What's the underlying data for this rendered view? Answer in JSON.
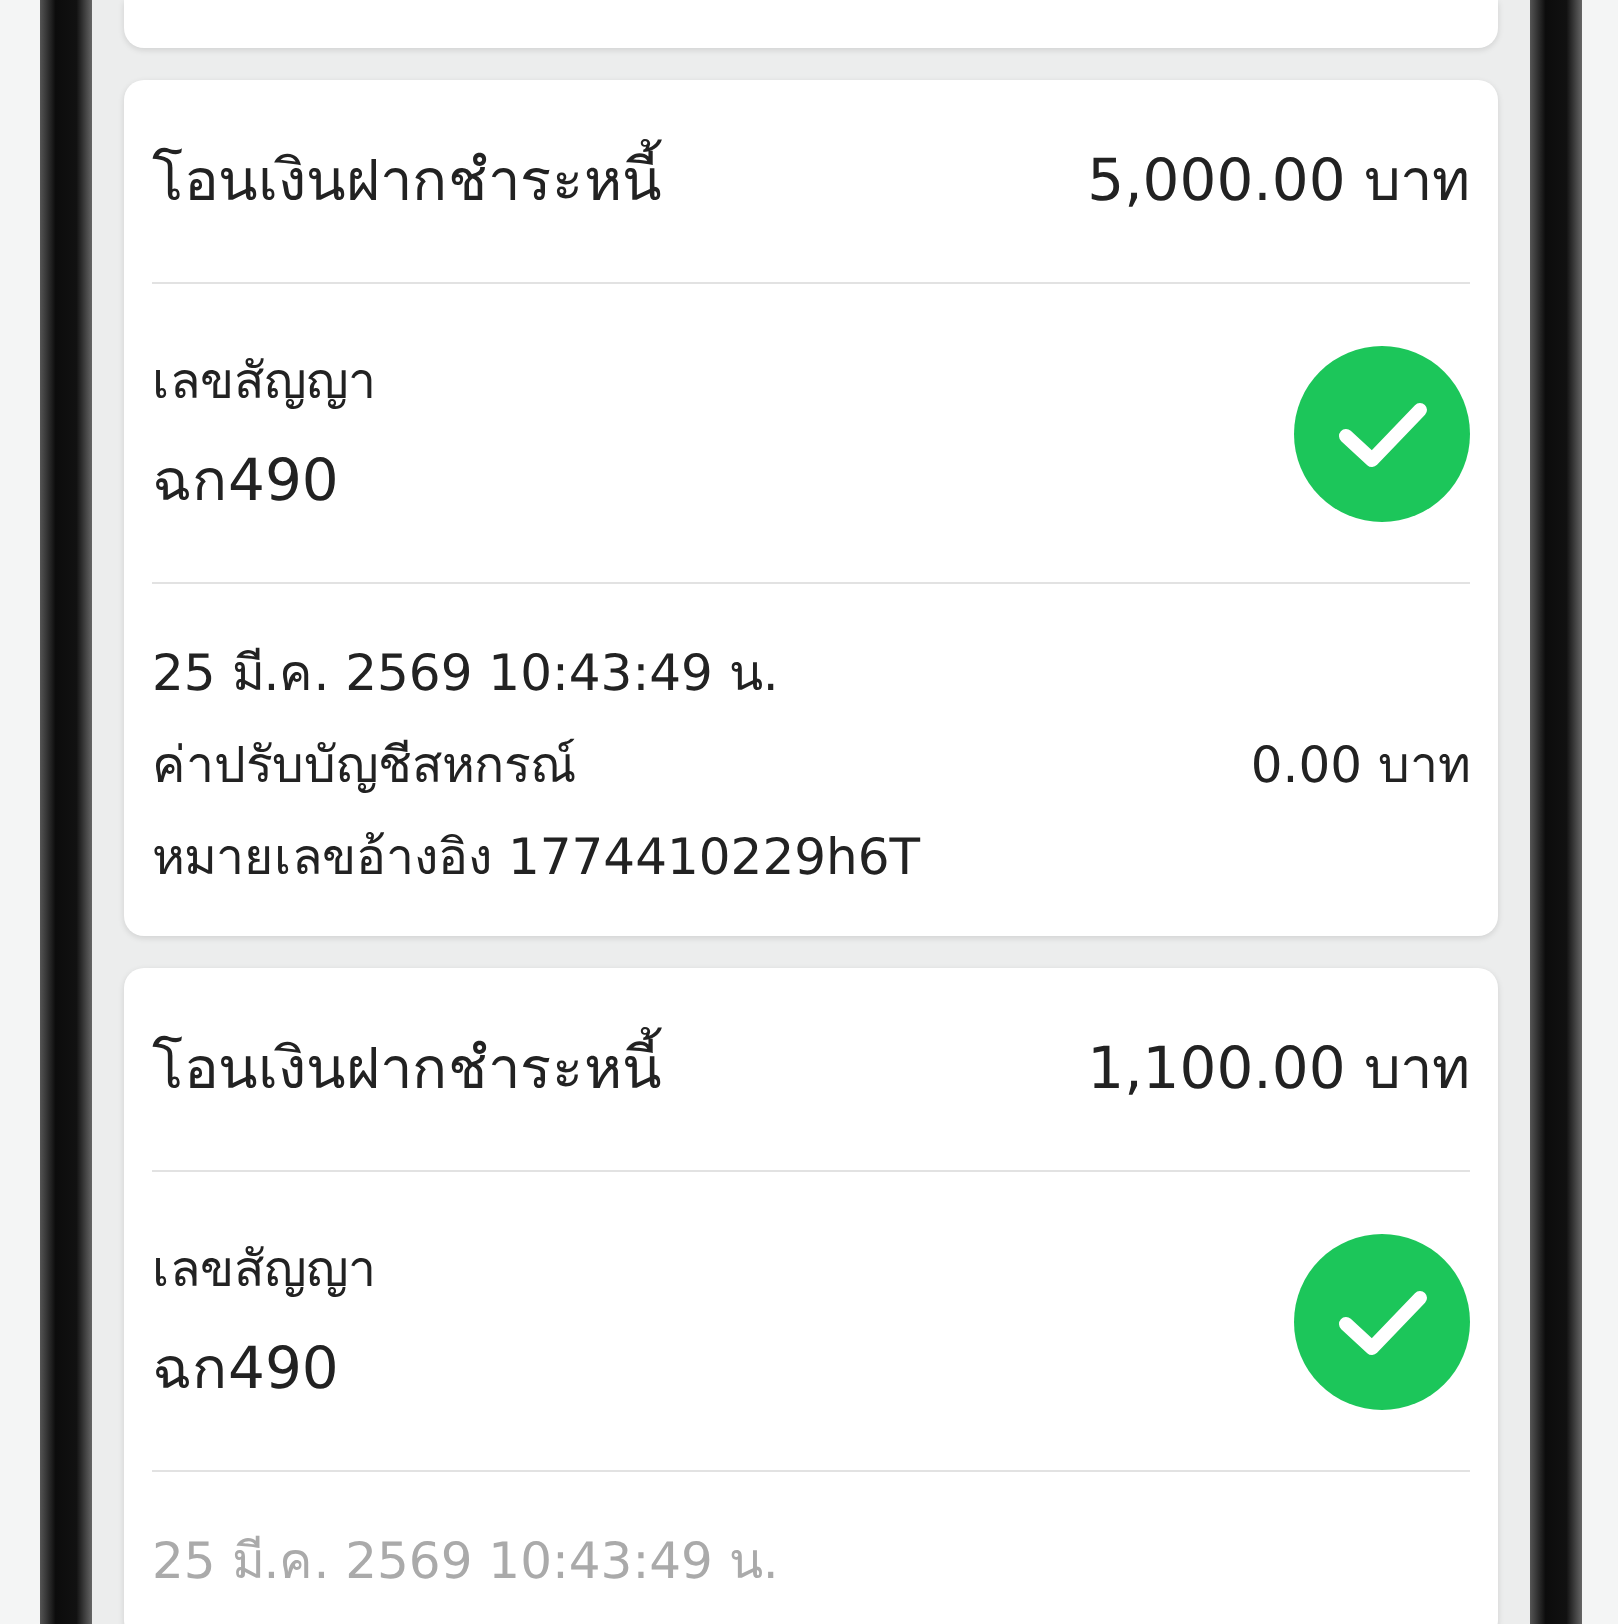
{
  "cards": [
    {
      "partial": true
    },
    {
      "title": "โอนเงินฝากชำระหนี้",
      "amount": "5,000.00 บาท",
      "contract_label": "เลขสัญญา",
      "contract_no": "ฉก490",
      "paid": true,
      "date": "25 มี.ค. 2569 10:43:49 น.",
      "fine_label": "ค่าปรับบัญชีสหกรณ์",
      "fine_amount": "0.00 บาท",
      "reference": "หมายเลขอ้างอิง 1774410229h6T"
    },
    {
      "title": "โอนเงินฝากชำระหนี้",
      "amount": "1,100.00 บาท",
      "contract_label": "เลขสัญญา",
      "contract_no": "ฉก490",
      "paid": true,
      "date": "25 มี.ค. 2569 10:43:49 น."
    }
  ]
}
